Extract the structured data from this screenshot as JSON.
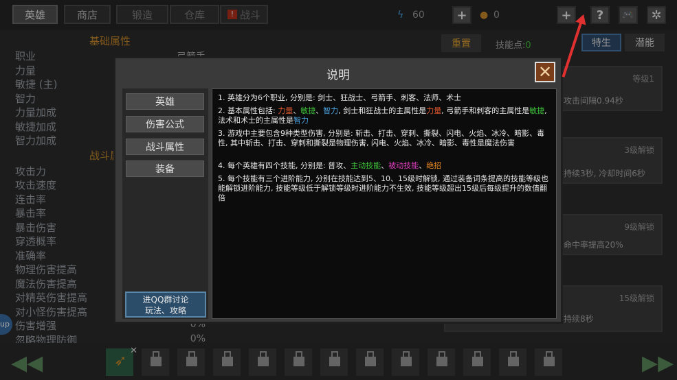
{
  "topbar": {
    "tabs": [
      {
        "label": "英雄",
        "active": true
      },
      {
        "label": "商店"
      },
      {
        "label": "锻造"
      },
      {
        "label": "仓库"
      },
      {
        "label": "战斗",
        "warning": true
      }
    ],
    "energy": "60",
    "coins": "0"
  },
  "left": {
    "base_title": "基础属性",
    "class_value": "弓箭手",
    "base_stats": [
      "职业",
      "力量",
      "敏捷 (主)",
      "智力",
      "力量加成",
      "敏捷加成",
      "智力加成"
    ],
    "combat_title": "战斗属性",
    "combat_stats": [
      "攻击力",
      "攻击速度",
      "连击率",
      "暴击率",
      "暴击伤害",
      "穿透概率",
      "准确率",
      "物理伤害提高",
      "魔法伤害提高",
      "对精英伤害提高",
      "对小怪伤害提高",
      "伤害增强",
      "忽略物理防御"
    ],
    "combat_values": [
      "0%",
      "0%"
    ],
    "fab_label": "up"
  },
  "right": {
    "reset_label": "重置",
    "skill_points_label": "技能点:",
    "skill_points_value": "0",
    "traits_label": "特生",
    "potential_label": "潜能",
    "cards": [
      {
        "level": "等级1",
        "desc": "攻击间隔0.94秒"
      },
      {
        "level": "3级解锁",
        "desc": "持续3秒, 冷却时间6秒"
      },
      {
        "level": "9级解锁",
        "desc": "命中率提高20%"
      },
      {
        "level": "15级解锁",
        "desc": "持续8秒"
      }
    ]
  },
  "modal": {
    "title": "说明",
    "sidebar": [
      "英雄",
      "伤害公式",
      "战斗属性",
      "装备"
    ],
    "qq_line1": "进QQ群讨论",
    "qq_line2": "玩法、攻略",
    "p1": "1. 英雄分为6个职业, 分别是: 剑士、狂战士、弓箭手、刺客、法师、术士",
    "p2a": "2. 基本属性包括: ",
    "p2_str": "力量",
    "p2_sep1": "、",
    "p2_agi": "敏捷",
    "p2_sep2": "、",
    "p2_int": "智力",
    "p2b": ", 剑士和狂战士的主属性是",
    "p2_str2": "力量",
    "p2c": ", 弓箭手和刺客的主属性是",
    "p2_agi2": "敏捷",
    "p2d": ", 法术和术士的主属性是",
    "p2_int2": "智力",
    "p3": "3. 游戏中主要包含9种类型伤害, 分别是: 斩击、打击、穿刺、撕裂、闪电、火焰、冰冷、暗影、毒性, 其中斩击、打击、穿刺和撕裂是物理伤害, 闪电、火焰、冰冷、暗影、毒性是魔法伤害",
    "p4a": "4. 每个英雄有四个技能, 分别是: 普攻、",
    "p4_active": "主动技能",
    "p4_sep1": "、",
    "p4_passive": "被动技能",
    "p4_sep2": "、",
    "p4_ult": "绝招",
    "p5": "5. 每个技能有三个进阶能力, 分别在技能达到5、10、15级时解锁, 通过装备词条提高的技能等级也能解锁进阶能力, 技能等级低于解锁等级时进阶能力不生效, 技能等级超出15级后每级提升的数值翻倍"
  },
  "colors": {
    "accent": "#c98a2a",
    "close": "#7a3e1b",
    "arrow": "#e03030"
  }
}
